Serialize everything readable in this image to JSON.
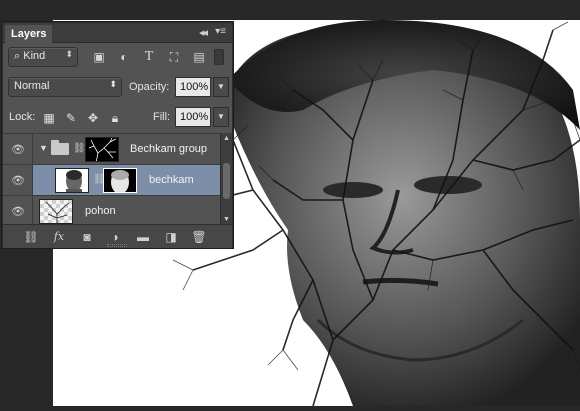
{
  "panel": {
    "tab_label": "Layers",
    "collapse_glyph": "◂◂",
    "menu_glyph": "▾≡"
  },
  "filter": {
    "kind_label": "Kind",
    "kind_icon": "search-icon",
    "icons": [
      "image-filter-icon",
      "adjustment-filter-icon",
      "type-filter-icon",
      "shape-filter-icon",
      "smart-object-filter-icon"
    ]
  },
  "blend": {
    "mode": "Normal",
    "opacity_label": "Opacity:",
    "opacity_value": "100%"
  },
  "lock": {
    "label": "Lock:",
    "fill_label": "Fill:",
    "fill_value": "100%",
    "icons": [
      "lock-transparent-icon",
      "lock-pixels-icon",
      "lock-position-icon",
      "lock-all-icon"
    ]
  },
  "layers": [
    {
      "name": "Bechkam group",
      "type": "group",
      "visible": true,
      "selected": false
    },
    {
      "name": "bechkam",
      "type": "layer",
      "visible": true,
      "selected": true
    },
    {
      "name": "pohon",
      "type": "layer",
      "visible": true,
      "selected": false
    }
  ],
  "footer_icons": [
    "link-layers-icon",
    "fx-icon",
    "add-mask-icon",
    "adjustment-layer-icon",
    "new-group-icon",
    "new-layer-icon",
    "trash-icon"
  ],
  "footer_fx_label": "fx",
  "colors": {
    "selected_row": "#7d8fa8",
    "panel_bg": "#535353",
    "app_bg": "#282828"
  }
}
